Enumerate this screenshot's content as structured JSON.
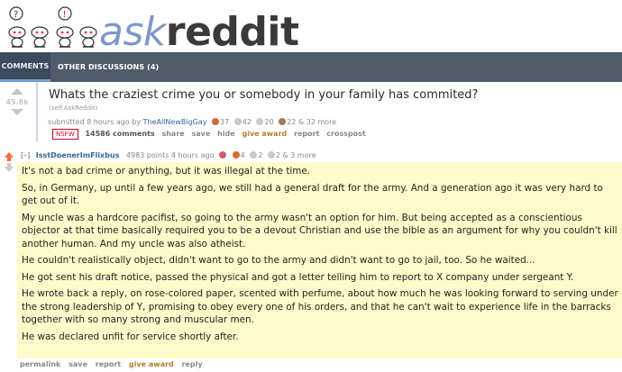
{
  "header": {
    "logo_prefix": "ask",
    "logo_suffix": "reddit"
  },
  "tabs": {
    "comments": "COMMENTS",
    "other": "OTHER DISCUSSIONS (4)"
  },
  "post": {
    "score": "45.8k",
    "title": "Whats the craziest crime you or somebody in your family has commited?",
    "domain": "(self.AskReddit)",
    "submitted": "submitted 8 hours ago by",
    "author": "TheAllNewBigGay",
    "awards": {
      "a1": "37",
      "a2": "42",
      "a3": "20",
      "a4": "22",
      "more": "& 32 more"
    },
    "nsfw": "NSFW",
    "comments": "14586 comments",
    "buttons": [
      "share",
      "save",
      "hide",
      "give award",
      "report",
      "crosspost"
    ]
  },
  "comment": {
    "collapse": "[–]",
    "author": "IsstDoenerImFlixbus",
    "meta": "4983 points 4 hours ago",
    "awards": {
      "a1": "4",
      "a2": "2",
      "a3": "2",
      "more": "& 3 more"
    },
    "paragraphs": [
      "It's not a bad crime or anything, but it was illegal at the time.",
      "So, in Germany, up until a few years ago, we still had a general draft for the army. And a generation ago it was very hard to get out of it.",
      "My uncle was a hardcore pacifist, so going to the army wasn't an option for him. But being accepted as a conscientious objector at that time basically required you to be a devout Christian and use the bible as an argument for why you couldn't kill another human. And my uncle was also atheist.",
      "He couldn't realistically object, didn't want to go to the army and didn't want to go to jail, too. So he waited...",
      "He got sent his draft notice, passed the physical and got a letter telling him to report to X company under sergeant Y.",
      "He wrote back a reply, on rose-colored paper, scented with perfume, about how much he was looking forward to serving under the strong leadership of Y, promising to obey every one of his orders, and that he can't wait to experience life in the barracks together with so many strong and muscular men.",
      "He was declared unfit for service shortly after."
    ],
    "buttons": [
      "permalink",
      "save",
      "report",
      "give award",
      "reply"
    ]
  },
  "colors": {
    "tabbar": "#4f5a6a",
    "comment_bg": "#fdfbc9",
    "upvote": "#ff6a2c",
    "link": "#336699",
    "nsfw": "#d10023"
  }
}
